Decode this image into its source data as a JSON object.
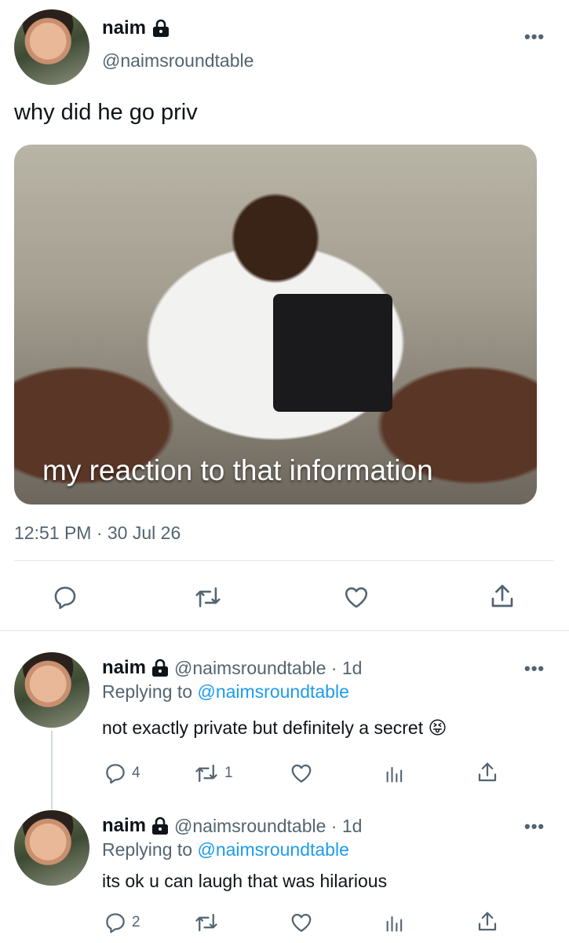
{
  "main_tweet": {
    "name": "naim",
    "handle": "@naimsroundtable",
    "more": "•••",
    "text": "why did he go priv",
    "media_caption": "my reaction to that information",
    "timestamp": "12:51 PM · 30 Jul 26"
  },
  "replies": [
    {
      "name": "naim",
      "handle_time": "@naimsroundtable · 1d",
      "replying_prefix": "Replying to",
      "replying_to": "@naimsroundtable",
      "text": "not exactly private but definitely a secret",
      "emoji": "😝",
      "reply_count": "4",
      "retweet_count": "1",
      "more": "•••"
    },
    {
      "name": "naim",
      "handle_time": "@naimsroundtable · 1d",
      "replying_prefix": "Replying to",
      "replying_to": "@naimsroundtable",
      "text": "its ok u can laugh that was hilarious",
      "reply_count": "2",
      "more": "•••"
    }
  ],
  "colors": {
    "text": "#0f1419",
    "secondary": "#536471",
    "link": "#1d9bf0",
    "divider": "#e1e6ea"
  },
  "icons": [
    "lock-icon",
    "reply-icon",
    "retweet-icon",
    "like-icon",
    "share-icon",
    "views-icon",
    "more-icon"
  ]
}
